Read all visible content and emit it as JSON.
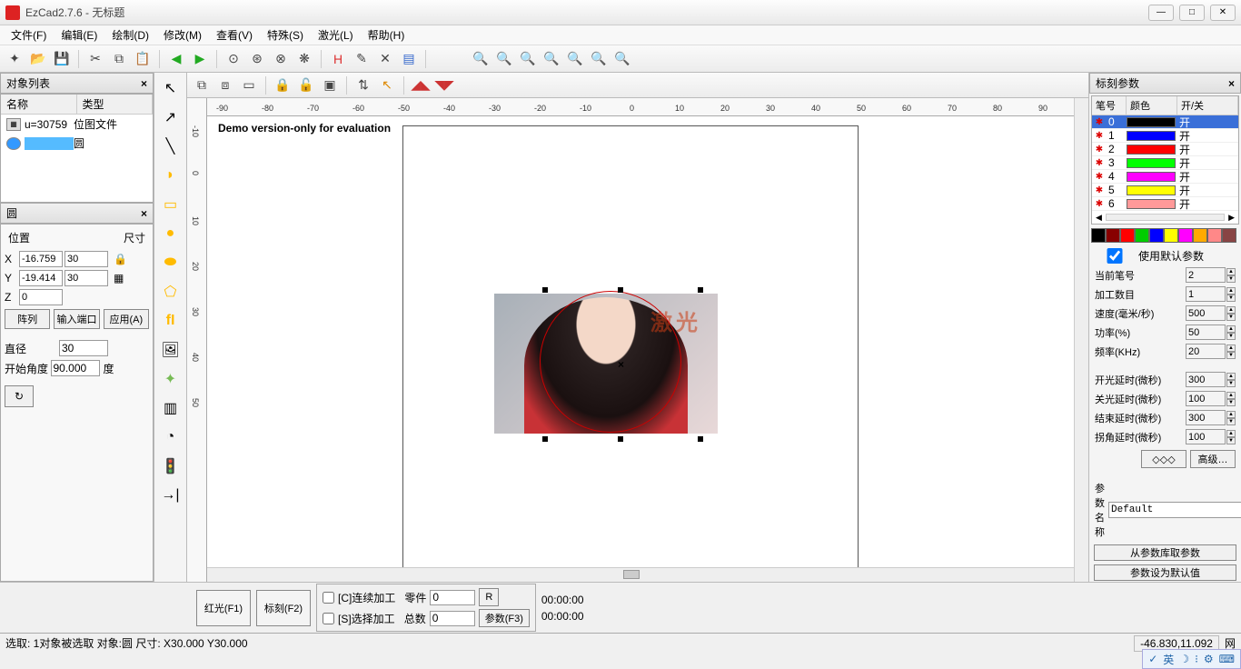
{
  "title": "EzCad2.7.6 - 无标题",
  "menu": [
    "文件(F)",
    "编辑(E)",
    "绘制(D)",
    "修改(M)",
    "查看(V)",
    "特殊(S)",
    "激光(L)",
    "帮助(H)"
  ],
  "left": {
    "obj_panel_title": "对象列表",
    "obj_cols": {
      "name": "名称",
      "type": "类型"
    },
    "obj_rows": [
      {
        "name": "u=30759",
        "type": "位图文件"
      },
      {
        "name": "",
        "type": "圆"
      }
    ],
    "props_title": "圆",
    "pos_label": "位置",
    "size_label": "尺寸",
    "x_lbl": "X",
    "x_pos": "-16.759",
    "x_size": "30",
    "y_lbl": "Y",
    "y_pos": "-19.414",
    "y_size": "30",
    "z_lbl": "Z",
    "z_pos": "0",
    "btns": [
      "阵列",
      "输入端口",
      "应用(A)"
    ],
    "diameter_lbl": "直径",
    "diameter": "30",
    "start_angle_lbl": "开始角度",
    "start_angle": "90.000",
    "deg": "度"
  },
  "canvas": {
    "demo": "Demo version-only for evaluation",
    "watermark": "激光"
  },
  "ruler_ticks": [
    "-90",
    "-80",
    "-70",
    "-60",
    "-50",
    "-40",
    "-30",
    "-20",
    "-10",
    "0",
    "10",
    "20",
    "30",
    "40",
    "50",
    "60",
    "70",
    "80",
    "90"
  ],
  "vruler_ticks": [
    "-10",
    "0",
    "10",
    "20",
    "30",
    "40",
    "50"
  ],
  "right": {
    "panel_title": "标刻参数",
    "pen_cols": {
      "no": "笔号",
      "color": "颜色",
      "onoff": "开/关"
    },
    "pens": [
      {
        "n": "0",
        "c": "#000000",
        "s": "开",
        "sel": true
      },
      {
        "n": "1",
        "c": "#0000ff",
        "s": "开"
      },
      {
        "n": "2",
        "c": "#ff0000",
        "s": "开"
      },
      {
        "n": "3",
        "c": "#00ff00",
        "s": "开"
      },
      {
        "n": "4",
        "c": "#ff00ff",
        "s": "开"
      },
      {
        "n": "5",
        "c": "#ffff00",
        "s": "开"
      },
      {
        "n": "6",
        "c": "#ff9999",
        "s": "开"
      }
    ],
    "palette": [
      "#000",
      "#800",
      "#f00",
      "#0c0",
      "#00f",
      "#ff0",
      "#f0f",
      "#fa0",
      "#f88",
      "#844"
    ],
    "use_default": "使用默认参数",
    "current_pen_lbl": "当前笔号",
    "current_pen": "2",
    "count_lbl": "加工数目",
    "count": "1",
    "speed_lbl": "速度(毫米/秒)",
    "speed": "500",
    "power_lbl": "功率(%)",
    "power": "50",
    "freq_lbl": "频率(KHz)",
    "freq": "20",
    "on_delay_lbl": "开光延时(微秒)",
    "on_delay": "300",
    "off_delay_lbl": "关光延时(微秒)",
    "off_delay": "100",
    "end_delay_lbl": "结束延时(微秒)",
    "end_delay": "300",
    "corner_delay_lbl": "拐角延时(微秒)",
    "corner_delay": "100",
    "adv_btn1": "◇◇◇",
    "adv_btn2": "高级…",
    "param_name_lbl": "参数名称",
    "param_name": "Default",
    "load_btn": "从参数库取参数",
    "save_btn": "参数设为默认值"
  },
  "bottom": {
    "red_btn": "红光(F1)",
    "mark_btn": "标刻(F2)",
    "cont_chk": "[C]连续加工",
    "sel_chk": "[S]选择加工",
    "parts_lbl": "零件",
    "parts": "0",
    "total_lbl": "总数",
    "total": "0",
    "r_btn": "R",
    "param_btn": "参数(F3)",
    "t1": "00:00:00",
    "t2": "00:00:00"
  },
  "status": {
    "sel": "选取: 1对象被选取 对象:圆 尺寸: X30.000 Y30.000",
    "coord": "-46.830,11.092",
    "grid": "网"
  },
  "taskbar": {
    "ime": "英"
  }
}
